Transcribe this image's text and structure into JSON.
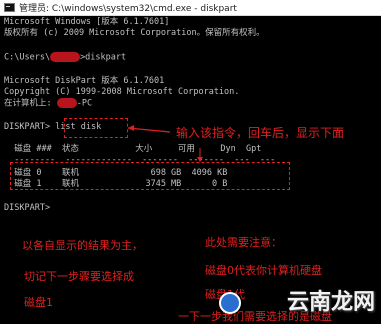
{
  "window": {
    "title": "管理员: C:\\windows\\system32\\cmd.exe - diskpart"
  },
  "console": {
    "l1": "Microsoft Windows [版本 6.1.7601]",
    "l2": "版权所有 (c) 2009 Microsoft Corporation。保留所有权利。",
    "l3_prefix": "C:\\Users\\",
    "l3_suffix": ">diskpart",
    "l4": "Microsoft DiskPart 版本 6.1.7601",
    "l5": "Copyright (C) 1999-2008 Microsoft Corporation.",
    "l6_prefix": "在计算机上: ",
    "l6_suffix": "-PC",
    "l7": "DISKPART> list disk",
    "header": "  磁盘 ###  状态           大小     可用     Dyn  Gpt",
    "divider": "  --------  -------------  -------  -------  ---  ---",
    "rows": [
      "  磁盘 0    联机              698 GB  4096 KB",
      "  磁盘 1    联机             3745 MB      0 B"
    ],
    "prompt": "DISKPART> "
  },
  "annotations": {
    "enter_cmd": "输入该指令，回车后，显示下面",
    "result_note": "以各自显示的结果为主，",
    "caution": "切记下一步骤要选择成",
    "disk1": "磁盘1",
    "notice": "此处需要注意：",
    "disk0_desc": "磁盘0代表你计算机硬盘",
    "disk1_desc": "磁盘1代",
    "next_step": "一下一步我们需要选择的是磁盘"
  },
  "watermark": "云南龙网",
  "colors": {
    "console_text": "#c0c0c0",
    "background": "#000000",
    "annotation": "#e02020",
    "redaction": "#b8141c"
  }
}
